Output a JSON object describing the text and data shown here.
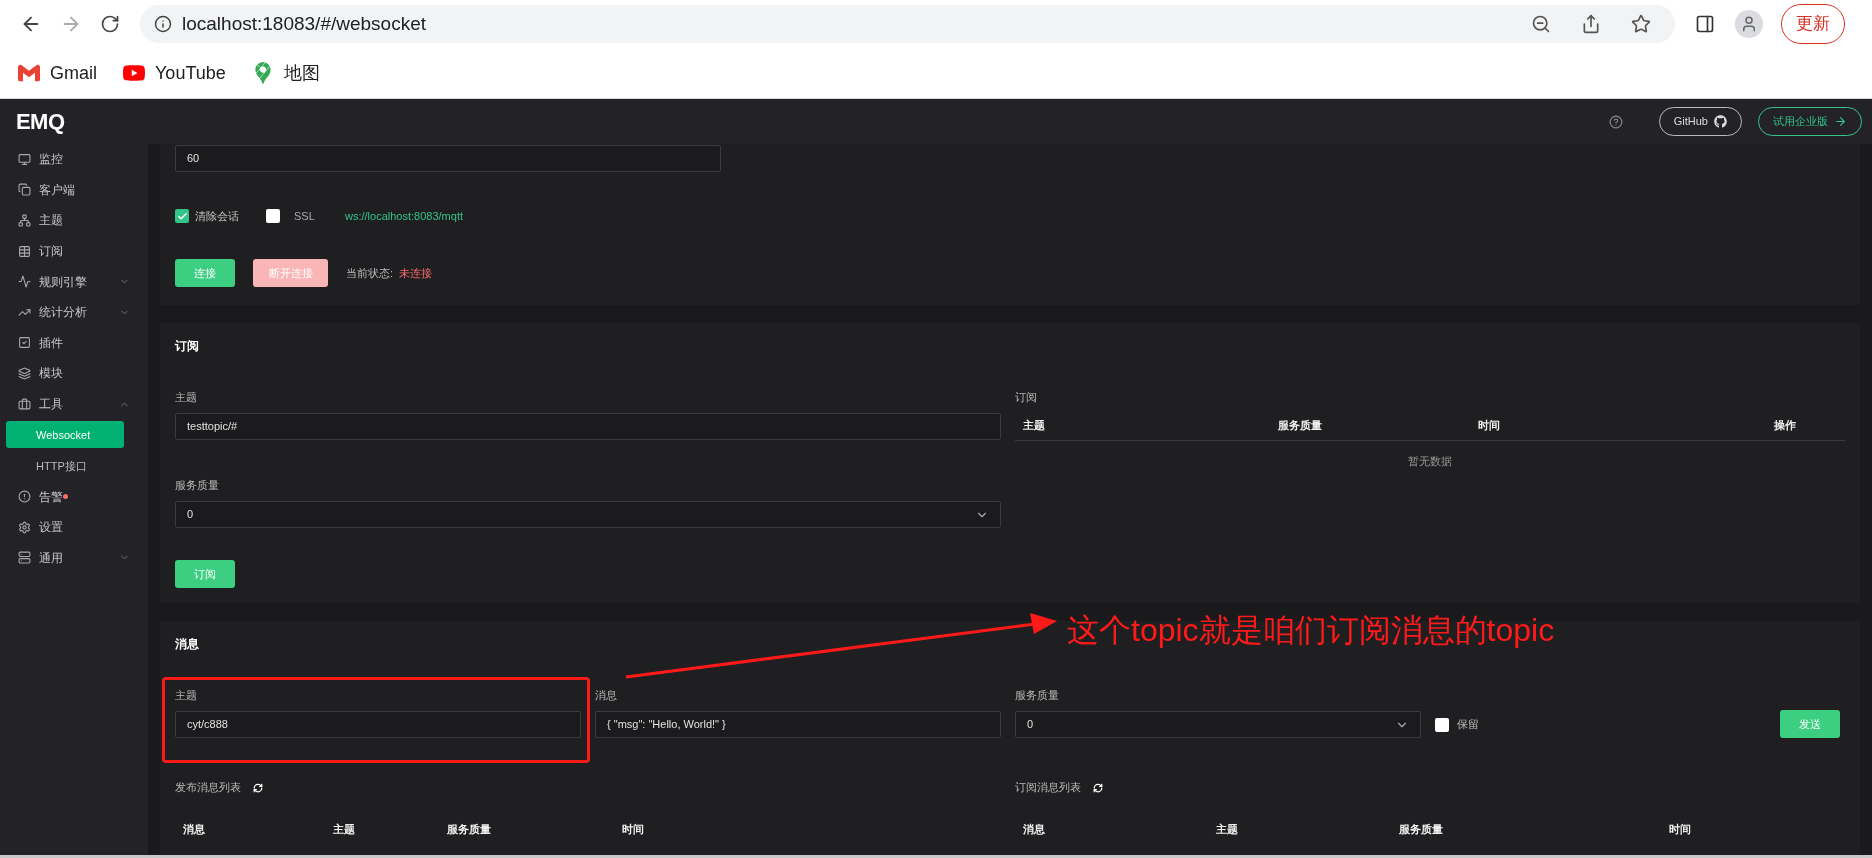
{
  "browser": {
    "url": "localhost:18083/#/websocket",
    "update_button": "更新",
    "bookmarks": [
      "Gmail",
      "YouTube",
      "地图"
    ]
  },
  "sidebar": {
    "logo": "EMQ",
    "items": [
      {
        "label": "监控",
        "selected": false
      },
      {
        "label": "客户端",
        "selected": false
      },
      {
        "label": "主题",
        "selected": false
      },
      {
        "label": "订阅",
        "selected": false
      },
      {
        "label": "规则引擎",
        "selected": false,
        "expanded": false
      },
      {
        "label": "统计分析",
        "selected": false,
        "expanded": false
      },
      {
        "label": "插件",
        "selected": false
      },
      {
        "label": "模块",
        "selected": false
      },
      {
        "label": "工具",
        "selected": false,
        "expanded": true,
        "children": [
          {
            "label": "Websocket",
            "selected": true
          },
          {
            "label": "HTTP接口",
            "selected": false
          }
        ]
      },
      {
        "label": "告警",
        "selected": false,
        "alert": true
      },
      {
        "label": "设置",
        "selected": false
      },
      {
        "label": "通用",
        "selected": false,
        "expanded": false
      }
    ]
  },
  "header": {
    "github_button": "GitHub",
    "enterprise_button": "试用企业版"
  },
  "connection": {
    "keepalive": "60",
    "clean_session": {
      "label": "清除会话",
      "checked": true
    },
    "ssl": {
      "label": "SSL",
      "checked": false
    },
    "url": "ws://localhost:8083/mqtt",
    "connect_button": "连接",
    "disconnect_button": {
      "label": "断开连接",
      "disabled": true
    },
    "status_label": "当前状态:",
    "status": "未连接",
    "connected": false
  },
  "subscribe": {
    "title": "订阅",
    "topic_label": "主题",
    "topic": "testtopic/#",
    "qos_label": "服务质量",
    "qos": "0",
    "button": "订阅",
    "table": {
      "title": "订阅",
      "columns": [
        "主题",
        "服务质量",
        "时间",
        "操作"
      ],
      "empty": "暂无数据"
    }
  },
  "message": {
    "title": "消息",
    "topic_label": "主题",
    "topic": "cyt/c888",
    "message_label": "消息",
    "message": "{ \"msg\": \"Hello, World!\" }",
    "qos_label": "服务质量",
    "qos": "0",
    "retain": {
      "label": "保留",
      "checked": false
    },
    "send_button": "发送",
    "published": {
      "title": "发布消息列表",
      "columns": [
        "消息",
        "主题",
        "服务质量",
        "时间"
      ]
    },
    "received": {
      "title": "订阅消息列表",
      "columns": [
        "消息",
        "主题",
        "服务质量",
        "时间"
      ]
    }
  },
  "annotation": {
    "text": "这个topic就是咱们订阅消息的topic"
  }
}
